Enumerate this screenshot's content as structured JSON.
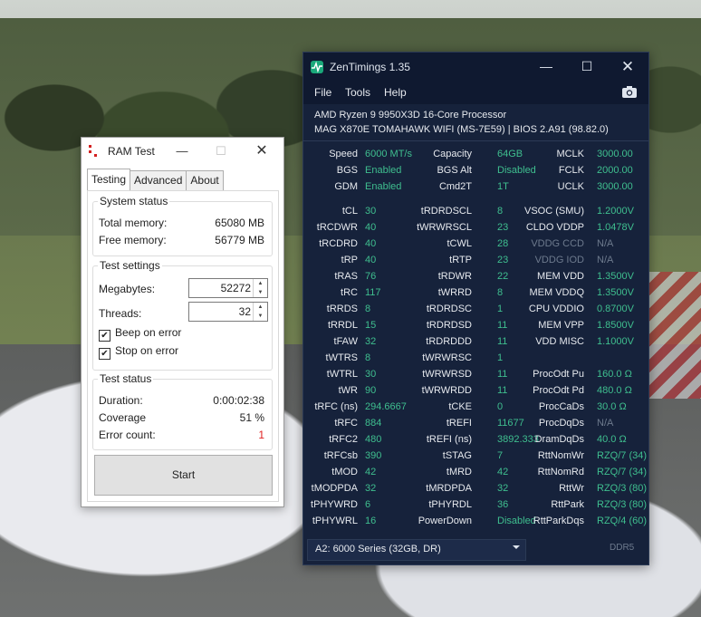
{
  "ramtest": {
    "title": "RAM Test",
    "tabs": [
      "Testing",
      "Advanced",
      "About"
    ],
    "system_status": {
      "title": "System status",
      "total_label": "Total memory:",
      "total_value": "65080 MB",
      "free_label": "Free memory:",
      "free_value": "56779 MB"
    },
    "test_settings": {
      "title": "Test settings",
      "megabytes_label": "Megabytes:",
      "megabytes_value": "52272",
      "threads_label": "Threads:",
      "threads_value": "32",
      "beep_label": "Beep on error",
      "beep_checked": true,
      "stop_label": "Stop on error",
      "stop_checked": true
    },
    "test_status": {
      "title": "Test status",
      "duration_label": "Duration:",
      "duration_value": "0:00:02:38",
      "coverage_label": "Coverage",
      "coverage_value": "51 %",
      "errors_label": "Error count:",
      "errors_value": "1"
    },
    "start_label": "Start"
  },
  "zentimings": {
    "title": "ZenTimings 1.35",
    "menu": [
      "File",
      "Tools",
      "Help"
    ],
    "cpu": "AMD Ryzen 9 9950X3D 16-Core Processor",
    "board": "MAG X870E TOMAHAWK WIFI (MS-7E59) | BIOS 2.A91 (98.82.0)",
    "info_rows": [
      [
        [
          "Speed",
          "6000 MT/s"
        ],
        [
          "Capacity",
          "64GB"
        ],
        [
          "MCLK",
          "3000.00"
        ]
      ],
      [
        [
          "BGS",
          "Enabled"
        ],
        [
          "BGS Alt",
          "Disabled"
        ],
        [
          "FCLK",
          "2000.00"
        ]
      ],
      [
        [
          "GDM",
          "Enabled"
        ],
        [
          "Cmd2T",
          "1T"
        ],
        [
          "UCLK",
          "3000.00"
        ]
      ]
    ],
    "timing_rows": [
      [
        [
          "tCL",
          "30"
        ],
        [
          "tRDRDSCL",
          "8"
        ],
        [
          "VSOC (SMU)",
          "1.2000V"
        ]
      ],
      [
        [
          "tRCDWR",
          "40"
        ],
        [
          "tWRWRSCL",
          "23"
        ],
        [
          "CLDO VDDP",
          "1.0478V"
        ]
      ],
      [
        [
          "tRCDRD",
          "40"
        ],
        [
          "tCWL",
          "28"
        ],
        [
          "VDDG CCD",
          "N/A"
        ]
      ],
      [
        [
          "tRP",
          "40"
        ],
        [
          "tRTP",
          "23"
        ],
        [
          "VDDG IOD",
          "N/A"
        ]
      ],
      [
        [
          "tRAS",
          "76"
        ],
        [
          "tRDWR",
          "22"
        ],
        [
          "MEM VDD",
          "1.3500V"
        ]
      ],
      [
        [
          "tRC",
          "117"
        ],
        [
          "tWRRD",
          "8"
        ],
        [
          "MEM VDDQ",
          "1.3500V"
        ]
      ],
      [
        [
          "tRRDS",
          "8"
        ],
        [
          "tRDRDSC",
          "1"
        ],
        [
          "CPU VDDIO",
          "0.8700V"
        ]
      ],
      [
        [
          "tRRDL",
          "15"
        ],
        [
          "tRDRDSD",
          "11"
        ],
        [
          "MEM VPP",
          "1.8500V"
        ]
      ],
      [
        [
          "tFAW",
          "32"
        ],
        [
          "tRDRDDD",
          "11"
        ],
        [
          "VDD MISC",
          "1.1000V"
        ]
      ],
      [
        [
          "tWTRS",
          "8"
        ],
        [
          "tWRWRSC",
          "1"
        ],
        [
          "",
          ""
        ]
      ],
      [
        [
          "tWTRL",
          "30"
        ],
        [
          "tWRWRSD",
          "11"
        ],
        [
          "ProcOdt Pu",
          "160.0 Ω"
        ]
      ],
      [
        [
          "tWR",
          "90"
        ],
        [
          "tWRWRDD",
          "11"
        ],
        [
          "ProcOdt Pd",
          "480.0 Ω"
        ]
      ],
      [
        [
          "tRFC (ns)",
          "294.6667"
        ],
        [
          "tCKE",
          "0"
        ],
        [
          "ProcCaDs",
          "30.0 Ω"
        ]
      ],
      [
        [
          "tRFC",
          "884"
        ],
        [
          "tREFI",
          "11677"
        ],
        [
          "ProcDqDs",
          "N/A"
        ]
      ],
      [
        [
          "tRFC2",
          "480"
        ],
        [
          "tREFI (ns)",
          "3892.333"
        ],
        [
          "DramDqDs",
          "40.0 Ω"
        ]
      ],
      [
        [
          "tRFCsb",
          "390"
        ],
        [
          "tSTAG",
          "7"
        ],
        [
          "RttNomWr",
          "RZQ/7 (34)"
        ]
      ],
      [
        [
          "tMOD",
          "42"
        ],
        [
          "tMRD",
          "42"
        ],
        [
          "RttNomRd",
          "RZQ/7 (34)"
        ]
      ],
      [
        [
          "tMODPDA",
          "32"
        ],
        [
          "tMRDPDA",
          "32"
        ],
        [
          "RttWr",
          "RZQ/3 (80)"
        ]
      ],
      [
        [
          "tPHYWRD",
          "6"
        ],
        [
          "tPHYRDL",
          "36"
        ],
        [
          "RttPark",
          "RZQ/3 (80)"
        ]
      ],
      [
        [
          "tPHYWRL",
          "16"
        ],
        [
          "PowerDown",
          "Disabled"
        ],
        [
          "RttParkDqs",
          "RZQ/4 (60)"
        ]
      ]
    ],
    "dim_labels": [
      "VDDG CCD",
      "VDDG IOD"
    ],
    "dim_values": [
      "N/A"
    ],
    "dimm_select": "A2: 6000 Series (32GB, DR)",
    "ddr_label": "DDR5",
    "accent_color": "#3fbf8f",
    "background_color": "#16223b"
  }
}
